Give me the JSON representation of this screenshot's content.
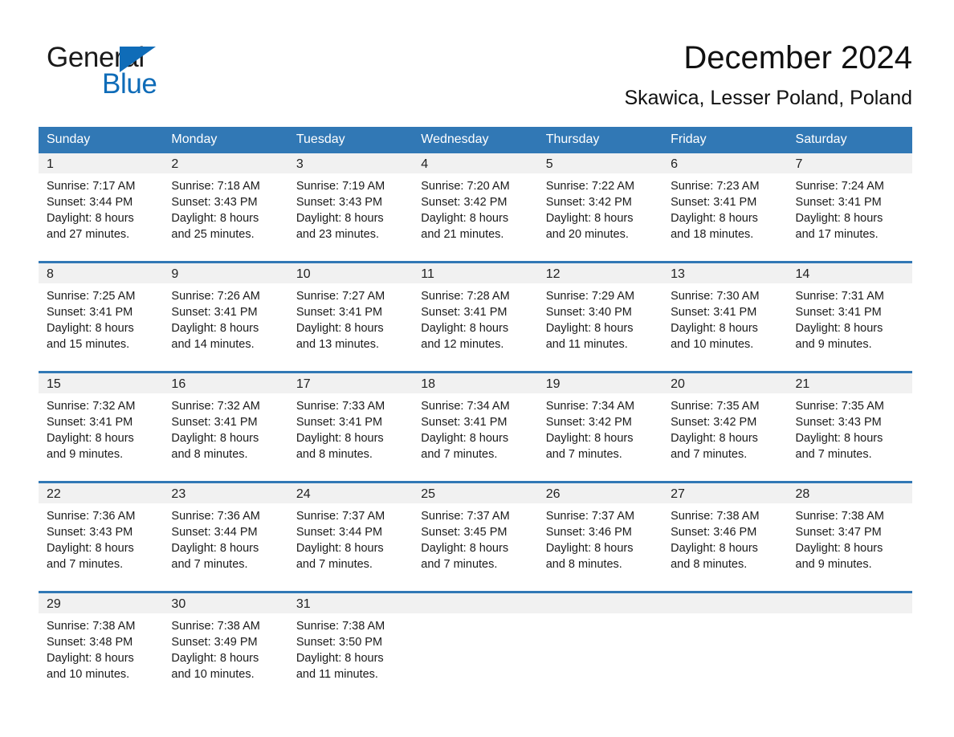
{
  "logo": {
    "word_one": "General",
    "word_two": "Blue",
    "triangle_color": "#0f6cb8",
    "text_color": "#1a1a1a"
  },
  "header": {
    "title": "December 2024",
    "subtitle": "Skawica, Lesser Poland, Poland"
  },
  "theme": {
    "header_blue": "#3178b5",
    "daynum_band_gray": "#f1f1f1",
    "page_background": "#ffffff",
    "text_color": "#1a1a1a"
  },
  "calendar": {
    "weekday_headers": [
      "Sunday",
      "Monday",
      "Tuesday",
      "Wednesday",
      "Thursday",
      "Friday",
      "Saturday"
    ],
    "weeks": [
      [
        {
          "day": "1",
          "sunrise": "Sunrise: 7:17 AM",
          "sunset": "Sunset: 3:44 PM",
          "daylight_line1": "Daylight: 8 hours",
          "daylight_line2": "and 27 minutes."
        },
        {
          "day": "2",
          "sunrise": "Sunrise: 7:18 AM",
          "sunset": "Sunset: 3:43 PM",
          "daylight_line1": "Daylight: 8 hours",
          "daylight_line2": "and 25 minutes."
        },
        {
          "day": "3",
          "sunrise": "Sunrise: 7:19 AM",
          "sunset": "Sunset: 3:43 PM",
          "daylight_line1": "Daylight: 8 hours",
          "daylight_line2": "and 23 minutes."
        },
        {
          "day": "4",
          "sunrise": "Sunrise: 7:20 AM",
          "sunset": "Sunset: 3:42 PM",
          "daylight_line1": "Daylight: 8 hours",
          "daylight_line2": "and 21 minutes."
        },
        {
          "day": "5",
          "sunrise": "Sunrise: 7:22 AM",
          "sunset": "Sunset: 3:42 PM",
          "daylight_line1": "Daylight: 8 hours",
          "daylight_line2": "and 20 minutes."
        },
        {
          "day": "6",
          "sunrise": "Sunrise: 7:23 AM",
          "sunset": "Sunset: 3:41 PM",
          "daylight_line1": "Daylight: 8 hours",
          "daylight_line2": "and 18 minutes."
        },
        {
          "day": "7",
          "sunrise": "Sunrise: 7:24 AM",
          "sunset": "Sunset: 3:41 PM",
          "daylight_line1": "Daylight: 8 hours",
          "daylight_line2": "and 17 minutes."
        }
      ],
      [
        {
          "day": "8",
          "sunrise": "Sunrise: 7:25 AM",
          "sunset": "Sunset: 3:41 PM",
          "daylight_line1": "Daylight: 8 hours",
          "daylight_line2": "and 15 minutes."
        },
        {
          "day": "9",
          "sunrise": "Sunrise: 7:26 AM",
          "sunset": "Sunset: 3:41 PM",
          "daylight_line1": "Daylight: 8 hours",
          "daylight_line2": "and 14 minutes."
        },
        {
          "day": "10",
          "sunrise": "Sunrise: 7:27 AM",
          "sunset": "Sunset: 3:41 PM",
          "daylight_line1": "Daylight: 8 hours",
          "daylight_line2": "and 13 minutes."
        },
        {
          "day": "11",
          "sunrise": "Sunrise: 7:28 AM",
          "sunset": "Sunset: 3:41 PM",
          "daylight_line1": "Daylight: 8 hours",
          "daylight_line2": "and 12 minutes."
        },
        {
          "day": "12",
          "sunrise": "Sunrise: 7:29 AM",
          "sunset": "Sunset: 3:40 PM",
          "daylight_line1": "Daylight: 8 hours",
          "daylight_line2": "and 11 minutes."
        },
        {
          "day": "13",
          "sunrise": "Sunrise: 7:30 AM",
          "sunset": "Sunset: 3:41 PM",
          "daylight_line1": "Daylight: 8 hours",
          "daylight_line2": "and 10 minutes."
        },
        {
          "day": "14",
          "sunrise": "Sunrise: 7:31 AM",
          "sunset": "Sunset: 3:41 PM",
          "daylight_line1": "Daylight: 8 hours",
          "daylight_line2": "and 9 minutes."
        }
      ],
      [
        {
          "day": "15",
          "sunrise": "Sunrise: 7:32 AM",
          "sunset": "Sunset: 3:41 PM",
          "daylight_line1": "Daylight: 8 hours",
          "daylight_line2": "and 9 minutes."
        },
        {
          "day": "16",
          "sunrise": "Sunrise: 7:32 AM",
          "sunset": "Sunset: 3:41 PM",
          "daylight_line1": "Daylight: 8 hours",
          "daylight_line2": "and 8 minutes."
        },
        {
          "day": "17",
          "sunrise": "Sunrise: 7:33 AM",
          "sunset": "Sunset: 3:41 PM",
          "daylight_line1": "Daylight: 8 hours",
          "daylight_line2": "and 8 minutes."
        },
        {
          "day": "18",
          "sunrise": "Sunrise: 7:34 AM",
          "sunset": "Sunset: 3:41 PM",
          "daylight_line1": "Daylight: 8 hours",
          "daylight_line2": "and 7 minutes."
        },
        {
          "day": "19",
          "sunrise": "Sunrise: 7:34 AM",
          "sunset": "Sunset: 3:42 PM",
          "daylight_line1": "Daylight: 8 hours",
          "daylight_line2": "and 7 minutes."
        },
        {
          "day": "20",
          "sunrise": "Sunrise: 7:35 AM",
          "sunset": "Sunset: 3:42 PM",
          "daylight_line1": "Daylight: 8 hours",
          "daylight_line2": "and 7 minutes."
        },
        {
          "day": "21",
          "sunrise": "Sunrise: 7:35 AM",
          "sunset": "Sunset: 3:43 PM",
          "daylight_line1": "Daylight: 8 hours",
          "daylight_line2": "and 7 minutes."
        }
      ],
      [
        {
          "day": "22",
          "sunrise": "Sunrise: 7:36 AM",
          "sunset": "Sunset: 3:43 PM",
          "daylight_line1": "Daylight: 8 hours",
          "daylight_line2": "and 7 minutes."
        },
        {
          "day": "23",
          "sunrise": "Sunrise: 7:36 AM",
          "sunset": "Sunset: 3:44 PM",
          "daylight_line1": "Daylight: 8 hours",
          "daylight_line2": "and 7 minutes."
        },
        {
          "day": "24",
          "sunrise": "Sunrise: 7:37 AM",
          "sunset": "Sunset: 3:44 PM",
          "daylight_line1": "Daylight: 8 hours",
          "daylight_line2": "and 7 minutes."
        },
        {
          "day": "25",
          "sunrise": "Sunrise: 7:37 AM",
          "sunset": "Sunset: 3:45 PM",
          "daylight_line1": "Daylight: 8 hours",
          "daylight_line2": "and 7 minutes."
        },
        {
          "day": "26",
          "sunrise": "Sunrise: 7:37 AM",
          "sunset": "Sunset: 3:46 PM",
          "daylight_line1": "Daylight: 8 hours",
          "daylight_line2": "and 8 minutes."
        },
        {
          "day": "27",
          "sunrise": "Sunrise: 7:38 AM",
          "sunset": "Sunset: 3:46 PM",
          "daylight_line1": "Daylight: 8 hours",
          "daylight_line2": "and 8 minutes."
        },
        {
          "day": "28",
          "sunrise": "Sunrise: 7:38 AM",
          "sunset": "Sunset: 3:47 PM",
          "daylight_line1": "Daylight: 8 hours",
          "daylight_line2": "and 9 minutes."
        }
      ],
      [
        {
          "day": "29",
          "sunrise": "Sunrise: 7:38 AM",
          "sunset": "Sunset: 3:48 PM",
          "daylight_line1": "Daylight: 8 hours",
          "daylight_line2": "and 10 minutes."
        },
        {
          "day": "30",
          "sunrise": "Sunrise: 7:38 AM",
          "sunset": "Sunset: 3:49 PM",
          "daylight_line1": "Daylight: 8 hours",
          "daylight_line2": "and 10 minutes."
        },
        {
          "day": "31",
          "sunrise": "Sunrise: 7:38 AM",
          "sunset": "Sunset: 3:50 PM",
          "daylight_line1": "Daylight: 8 hours",
          "daylight_line2": "and 11 minutes."
        },
        {
          "day": "",
          "sunrise": "",
          "sunset": "",
          "daylight_line1": "",
          "daylight_line2": ""
        },
        {
          "day": "",
          "sunrise": "",
          "sunset": "",
          "daylight_line1": "",
          "daylight_line2": ""
        },
        {
          "day": "",
          "sunrise": "",
          "sunset": "",
          "daylight_line1": "",
          "daylight_line2": ""
        },
        {
          "day": "",
          "sunrise": "",
          "sunset": "",
          "daylight_line1": "",
          "daylight_line2": ""
        }
      ]
    ]
  }
}
